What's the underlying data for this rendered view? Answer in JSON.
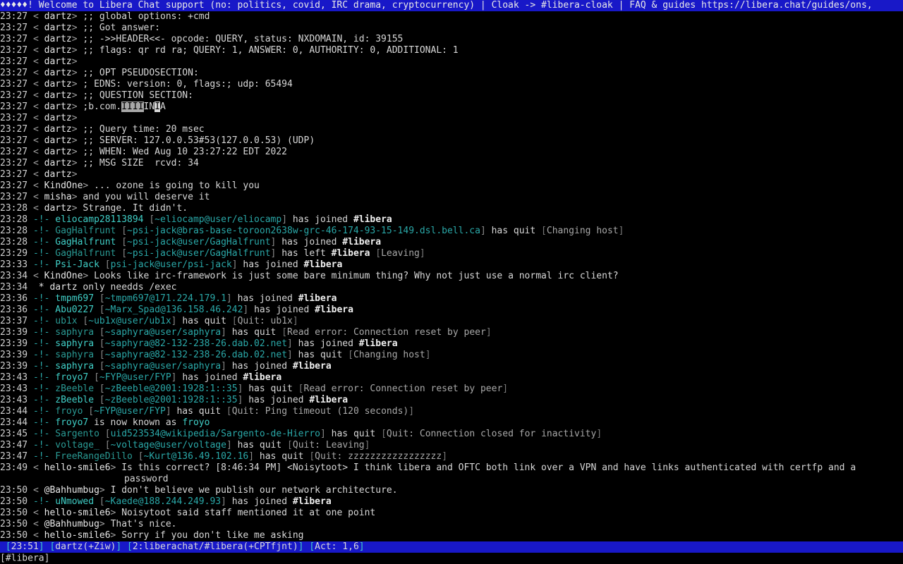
{
  "topic": "♦♦♦♦♦! Welcome to Libera Chat support (no: politics, covid, IRC drama, cryptocurrency) | Cloak -> #libera-cloak | FAQ & guides https://libera.chat/guides/ons,",
  "messages": [
    {
      "kind": "msg",
      "time": "23:27",
      "nick": "dartz",
      "text": ";; global options: +cmd"
    },
    {
      "kind": "msg",
      "time": "23:27",
      "nick": "dartz",
      "text": ";; Got answer:"
    },
    {
      "kind": "msg",
      "time": "23:27",
      "nick": "dartz",
      "text": ";; ->>HEADER<<- opcode: QUERY, status: NXDOMAIN, id: 39155"
    },
    {
      "kind": "msg",
      "time": "23:27",
      "nick": "dartz",
      "text": ";; flags: qr rd ra; QUERY: 1, ANSWER: 0, AUTHORITY: 0, ADDITIONAL: 1"
    },
    {
      "kind": "msg",
      "time": "23:27",
      "nick": "dartz",
      "text": ""
    },
    {
      "kind": "msg",
      "time": "23:27",
      "nick": "dartz",
      "text": ";; OPT PSEUDOSECTION:"
    },
    {
      "kind": "msg",
      "time": "23:27",
      "nick": "dartz",
      "text": "; EDNS: version: 0, flags:; udp: 65494"
    },
    {
      "kind": "msg",
      "time": "23:27",
      "nick": "dartz",
      "text": ";; QUESTION SECTION:"
    },
    {
      "kind": "msg",
      "time": "23:27",
      "nick": "dartz",
      "text": ";b.com.",
      "hl1": "IIII",
      "mid": "IN",
      "hl2": "I",
      "tail": "A"
    },
    {
      "kind": "msg",
      "time": "23:27",
      "nick": "dartz",
      "text": ""
    },
    {
      "kind": "msg",
      "time": "23:27",
      "nick": "dartz",
      "text": ";; Query time: 20 msec"
    },
    {
      "kind": "msg",
      "time": "23:27",
      "nick": "dartz",
      "text": ";; SERVER: 127.0.0.53#53(127.0.0.53) (UDP)"
    },
    {
      "kind": "msg",
      "time": "23:27",
      "nick": "dartz",
      "text": ";; WHEN: Wed Aug 10 23:27:22 EDT 2022"
    },
    {
      "kind": "msg",
      "time": "23:27",
      "nick": "dartz",
      "text": ";; MSG SIZE  rcvd: 34"
    },
    {
      "kind": "msg",
      "time": "23:27",
      "nick": "dartz",
      "text": ""
    },
    {
      "kind": "msg",
      "time": "23:27",
      "nick": "KindOne",
      "text": "... ozone is going to kill you"
    },
    {
      "kind": "msg",
      "time": "23:27",
      "nick": "misha",
      "text": "and you will deserve it"
    },
    {
      "kind": "msg",
      "time": "23:28",
      "nick": "dartz",
      "text": "Strange. It didn't."
    },
    {
      "kind": "join",
      "time": "23:28",
      "nick": "eliocamp28113894",
      "host": "~eliocamp@user/eliocamp",
      "action": "has joined",
      "channel": "#libera"
    },
    {
      "kind": "quit",
      "time": "23:28",
      "nick": "GagHalfrunt",
      "host": "~psi-jack@bras-base-toroon2638w-grc-46-174-93-15-149.dsl.bell.ca",
      "action": "has quit",
      "reason": "Changing host"
    },
    {
      "kind": "join",
      "time": "23:28",
      "nick": "GagHalfrunt",
      "host": "~psi-jack@user/GagHalfrunt",
      "action": "has joined",
      "channel": "#libera"
    },
    {
      "kind": "part",
      "time": "23:29",
      "nick": "GagHalfrunt",
      "host": "~psi-jack@user/GagHalfrunt",
      "action": "has left",
      "channel": "#libera",
      "reason": "Leaving"
    },
    {
      "kind": "join",
      "time": "23:33",
      "nick": "Psi-Jack",
      "host": "psi-jack@user/psi-jack",
      "action": "has joined",
      "channel": "#libera"
    },
    {
      "kind": "msg",
      "time": "23:34",
      "nick": "KindOne",
      "text": "Looks like irc-framework is just some bare minimum thing? Why not just use a normal irc client?"
    },
    {
      "kind": "action",
      "time": "23:34",
      "nick": "dartz",
      "text": "only needds /exec"
    },
    {
      "kind": "join",
      "time": "23:36",
      "nick": "tmpm697",
      "host": "~tmpm697@171.224.179.1",
      "action": "has joined",
      "channel": "#libera"
    },
    {
      "kind": "join",
      "time": "23:36",
      "nick": "Abu0227",
      "host": "~Marx_Spad@136.158.46.242",
      "action": "has joined",
      "channel": "#libera"
    },
    {
      "kind": "quit",
      "time": "23:37",
      "nick": "ub1x",
      "host": "~ub1x@user/ub1x",
      "action": "has quit",
      "reason": "Quit: ub1x"
    },
    {
      "kind": "quit",
      "time": "23:39",
      "nick": "saphyra",
      "host": "~saphyra@user/saphyra",
      "action": "has quit",
      "reason": "Read error: Connection reset by peer"
    },
    {
      "kind": "join",
      "time": "23:39",
      "nick": "saphyra",
      "host": "~saphyra@82-132-238-26.dab.02.net",
      "action": "has joined",
      "channel": "#libera"
    },
    {
      "kind": "quit",
      "time": "23:39",
      "nick": "saphyra",
      "host": "~saphyra@82-132-238-26.dab.02.net",
      "action": "has quit",
      "reason": "Changing host"
    },
    {
      "kind": "join",
      "time": "23:39",
      "nick": "saphyra",
      "host": "~saphyra@user/saphyra",
      "action": "has joined",
      "channel": "#libera"
    },
    {
      "kind": "join",
      "time": "23:43",
      "nick": "froyo7",
      "host": "~FYP@user/FYP",
      "action": "has joined",
      "channel": "#libera"
    },
    {
      "kind": "quit",
      "time": "23:43",
      "nick": "zBeeble",
      "host": "~zBeeble@2001:1928:1::35",
      "action": "has quit",
      "reason": "Read error: Connection reset by peer"
    },
    {
      "kind": "join",
      "time": "23:43",
      "nick": "zBeeble",
      "host": "~zBeeble@2001:1928:1::35",
      "action": "has joined",
      "channel": "#libera"
    },
    {
      "kind": "quit",
      "time": "23:44",
      "nick": "froyo",
      "host": "~FYP@user/FYP",
      "action": "has quit",
      "reason": "Quit: Ping timeout (120 seconds)"
    },
    {
      "kind": "nickchange",
      "time": "23:44",
      "nick": "froyo7",
      "action": "is now known as",
      "newnick": "froyo"
    },
    {
      "kind": "quit",
      "time": "23:45",
      "nick": "Sargento",
      "host": "uid523534@wikipedia/Sargento-de-Hierro",
      "action": "has quit",
      "reason": "Quit: Connection closed for inactivity"
    },
    {
      "kind": "quit",
      "time": "23:47",
      "nick": "voltage_",
      "host": "~voltage@user/voltage",
      "action": "has quit",
      "reason": "Quit: Leaving"
    },
    {
      "kind": "quit",
      "time": "23:47",
      "nick": "FreeRangeDillo",
      "host": "~Kurt@136.49.102.16",
      "action": "has quit",
      "reason": "Quit: zzzzzzzzzzzzzzzzz"
    },
    {
      "kind": "msg",
      "time": "23:49",
      "nick": "hello-smile6",
      "text": "Is this correct? [8:46:34 PM] <Noisytoot> I think libera and OFTC both link over a VPN and have links authenticated with certfp and a",
      "cont": "password"
    },
    {
      "kind": "msg",
      "time": "23:50",
      "nick": "@Bahhumbug",
      "text": "I don't believe we publish our network architecture."
    },
    {
      "kind": "join",
      "time": "23:50",
      "nick": "uNmowed",
      "host": "~Kaede@188.244.249.93",
      "action": "has joined",
      "channel": "#libera"
    },
    {
      "kind": "msg",
      "time": "23:50",
      "nick": "hello-smile6",
      "text": "Noisytoot said staff mentioned it at one point"
    },
    {
      "kind": "msg",
      "time": "23:50",
      "nick": "@Bahhumbug",
      "text": "That's nice."
    },
    {
      "kind": "msg",
      "time": "23:50",
      "nick": "hello-smile6",
      "text": "Sorry if you don't like me asking"
    }
  ],
  "status": {
    "time": "23:51",
    "user": "dartz(+Ziw)",
    "window": "2:liberachat/#libera(+CPTfjnt)",
    "act": "Act: 1,6"
  },
  "input": {
    "prompt": "[#libera]",
    "value": ""
  },
  "colors": {
    "topic_bg": "#1818c8",
    "status_bg": "#1818c8",
    "event_accent": "#2aa8a8"
  }
}
